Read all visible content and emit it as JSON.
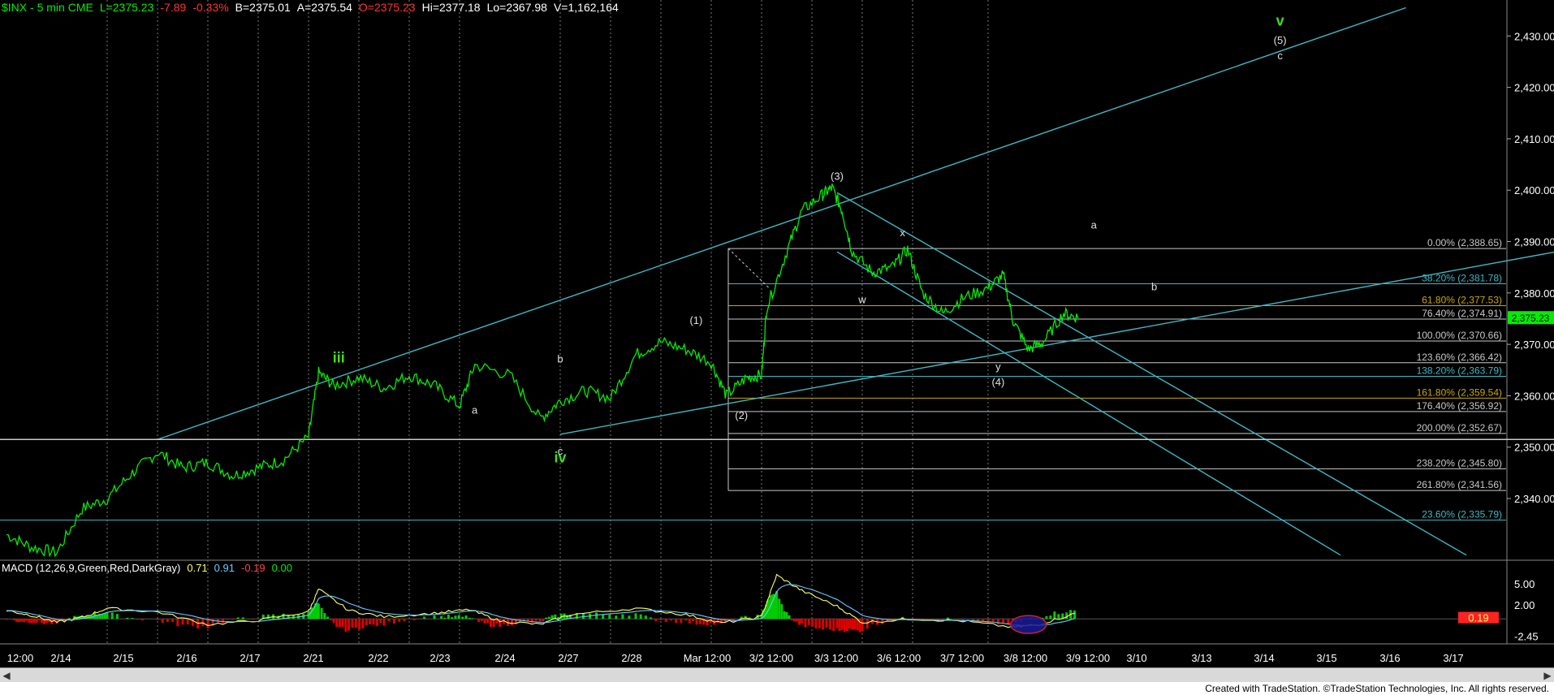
{
  "header": {
    "symbol": "$INX - 5 min  CME",
    "last": "L=2375.23",
    "change": "-7.89",
    "change_pct": "-0.33%",
    "bid": "B=2375.01",
    "ask": "A=2375.54",
    "open": "O=2375.23",
    "high": "Hi=2377.18",
    "low": "Lo=2367.98",
    "volume": "V=1,162,164"
  },
  "macd_header": {
    "name": "MACD (12,26,9,Green,Red,DarkGray)",
    "v1": "0.71",
    "v2": "0.91",
    "v3": "-0.19",
    "v4": "0.00"
  },
  "footer": {
    "credit": "Created with TradeStation. ©TradeStation Technologies, Inc. All rights reserved."
  },
  "colors": {
    "price": "#00ee00",
    "trendline": "#3fb8c4",
    "fib_line": "#c8c8c8",
    "label_white": "#e0e0e0",
    "label_green": "#44dd22",
    "axis_text": "#ffffff",
    "current_price_bg": "#00ee00"
  },
  "chart_data": {
    "type": "line",
    "title": "$INX - 5 min",
    "ylim": [
      2328,
      2437
    ],
    "y_ticks": [
      2340,
      2350,
      2360,
      2370,
      2380,
      2390,
      2400,
      2410,
      2420,
      2430
    ],
    "y_tick_labels": [
      "2,340.00",
      "2,350.00",
      "2,360.00",
      "2,370.00",
      "2,380.00",
      "2,390.00",
      "2,400.00",
      "2,410.00",
      "2,420.00",
      "2,430.00"
    ],
    "x_tick_labels": [
      "12:00",
      "2/14",
      "2/15",
      "2/16",
      "2/17",
      "2/21",
      "2/22",
      "2/23",
      "2/24",
      "2/27",
      "2/28",
      "Mar 12:00",
      "3/2 12:00",
      "3/3 12:00",
      "3/6 12:00",
      "3/7 12:00",
      "3/8 12:00",
      "3/9 12:00",
      "3/10",
      "3/13",
      "3/14",
      "3/15",
      "3/16",
      "3/17"
    ],
    "current_price_label": "2,375.23",
    "price_series": [
      {
        "x": 0.0,
        "y": 2333.0
      },
      {
        "x": 0.5,
        "y": 2330.5
      },
      {
        "x": 1.0,
        "y": 2329.5
      },
      {
        "x": 1.5,
        "y": 2338.0
      },
      {
        "x": 2.0,
        "y": 2340.0
      },
      {
        "x": 2.5,
        "y": 2345.0
      },
      {
        "x": 3.0,
        "y": 2349.0
      },
      {
        "x": 3.5,
        "y": 2346.0
      },
      {
        "x": 4.0,
        "y": 2347.0
      },
      {
        "x": 4.5,
        "y": 2344.5
      },
      {
        "x": 5.0,
        "y": 2346.0
      },
      {
        "x": 5.5,
        "y": 2347.5
      },
      {
        "x": 6.0,
        "y": 2352.0
      },
      {
        "x": 6.2,
        "y": 2364.5
      },
      {
        "x": 6.5,
        "y": 2362.0
      },
      {
        "x": 7.0,
        "y": 2363.5
      },
      {
        "x": 7.5,
        "y": 2361.5
      },
      {
        "x": 8.0,
        "y": 2364.0
      },
      {
        "x": 8.5,
        "y": 2362.0
      },
      {
        "x": 9.0,
        "y": 2358.0
      },
      {
        "x": 9.3,
        "y": 2366.0
      },
      {
        "x": 10.0,
        "y": 2364.0
      },
      {
        "x": 10.6,
        "y": 2355.5
      },
      {
        "x": 11.0,
        "y": 2359.0
      },
      {
        "x": 11.5,
        "y": 2361.0
      },
      {
        "x": 12.0,
        "y": 2359.5
      },
      {
        "x": 12.5,
        "y": 2368.0
      },
      {
        "x": 13.0,
        "y": 2370.5
      },
      {
        "x": 13.5,
        "y": 2369.0
      },
      {
        "x": 14.0,
        "y": 2366.5
      },
      {
        "x": 14.3,
        "y": 2360.0
      },
      {
        "x": 14.7,
        "y": 2363.5
      },
      {
        "x": 15.0,
        "y": 2364.0
      },
      {
        "x": 15.1,
        "y": 2377.0
      },
      {
        "x": 15.5,
        "y": 2388.0
      },
      {
        "x": 15.8,
        "y": 2396.0
      },
      {
        "x": 16.2,
        "y": 2399.0
      },
      {
        "x": 16.4,
        "y": 2400.5
      },
      {
        "x": 16.6,
        "y": 2396.0
      },
      {
        "x": 16.8,
        "y": 2388.0
      },
      {
        "x": 17.2,
        "y": 2384.0
      },
      {
        "x": 17.6,
        "y": 2385.0
      },
      {
        "x": 17.9,
        "y": 2388.5
      },
      {
        "x": 18.2,
        "y": 2380.0
      },
      {
        "x": 18.6,
        "y": 2376.0
      },
      {
        "x": 19.0,
        "y": 2379.0
      },
      {
        "x": 19.5,
        "y": 2381.0
      },
      {
        "x": 19.8,
        "y": 2383.5
      },
      {
        "x": 20.0,
        "y": 2374.5
      },
      {
        "x": 20.3,
        "y": 2369.0
      },
      {
        "x": 20.6,
        "y": 2370.5
      },
      {
        "x": 21.0,
        "y": 2376.0
      },
      {
        "x": 21.3,
        "y": 2375.2
      }
    ],
    "trendlines": [
      {
        "name": "upper-channel",
        "x1": 3.0,
        "y1": 2351.5,
        "x2": 27.8,
        "y2": 2435.5
      },
      {
        "name": "lower-channel",
        "x1": 11.0,
        "y1": 2352.5,
        "x2": 33.0,
        "y2": 2392.0
      },
      {
        "name": "down-channel-top",
        "x1": 16.5,
        "y1": 2399.5,
        "x2": 29.0,
        "y2": 2329.0
      },
      {
        "name": "down-channel-bottom",
        "x1": 16.5,
        "y1": 2388.0,
        "x2": 26.5,
        "y2": 2329.0
      },
      {
        "name": "flat-support",
        "x1": -0.5,
        "y1": 2351.5,
        "x2": 33.0,
        "y2": 2351.5
      }
    ],
    "fib_levels": [
      {
        "pct": "0.00%",
        "price": "2,388.65",
        "value": 2388.65,
        "color": "#c8c8c8"
      },
      {
        "pct": "38.20%",
        "price": "2,381.78",
        "value": 2381.78,
        "color": "#3fb8c4"
      },
      {
        "pct": "61.80%",
        "price": "2,377.53",
        "value": 2377.53,
        "color": "#c8a800"
      },
      {
        "pct": "76.40%",
        "price": "2,374.91",
        "value": 2374.91,
        "color": "#c8c8c8"
      },
      {
        "pct": "100.00%",
        "price": "2,370.66",
        "value": 2370.66,
        "color": "#c8c8c8"
      },
      {
        "pct": "123.60%",
        "price": "2,366.42",
        "value": 2366.42,
        "color": "#c8c8c8"
      },
      {
        "pct": "138.20%",
        "price": "2,363.79",
        "value": 2363.79,
        "color": "#3fb8c4"
      },
      {
        "pct": "161.80%",
        "price": "2,359.54",
        "value": 2359.54,
        "color": "#c8a800"
      },
      {
        "pct": "176.40%",
        "price": "2,356.92",
        "value": 2356.92,
        "color": "#c8c8c8"
      },
      {
        "pct": "200.00%",
        "price": "2,352.67",
        "value": 2352.67,
        "color": "#c8c8c8"
      },
      {
        "pct": "238.20%",
        "price": "2,345.80",
        "value": 2345.8,
        "color": "#c8c8c8"
      },
      {
        "pct": "261.80%",
        "price": "2,341.56",
        "value": 2341.56,
        "color": "#c8c8c8"
      },
      {
        "pct": "23.60%",
        "price": "2,335.79",
        "value": 2335.79,
        "color": "#3fb8c4"
      }
    ],
    "wave_labels": [
      {
        "text": "iii",
        "x": 6.6,
        "y": 2366.5,
        "color": "green"
      },
      {
        "text": "iv",
        "x": 11.0,
        "y": 2347.0,
        "color": "green"
      },
      {
        "text": "v",
        "x": 25.3,
        "y": 2432.0,
        "color": "green"
      },
      {
        "text": "a",
        "x": 9.3,
        "y": 2356.5,
        "color": "white"
      },
      {
        "text": "b",
        "x": 11.0,
        "y": 2366.5,
        "color": "white"
      },
      {
        "text": "c",
        "x": 11.0,
        "y": 2348.5,
        "color": "white"
      },
      {
        "text": "(1)",
        "x": 13.7,
        "y": 2374.0,
        "color": "white"
      },
      {
        "text": "(2)",
        "x": 14.6,
        "y": 2355.5,
        "color": "white"
      },
      {
        "text": "(3)",
        "x": 16.5,
        "y": 2402.0,
        "color": "white"
      },
      {
        "text": "w",
        "x": 17.0,
        "y": 2378.0,
        "color": "white"
      },
      {
        "text": "x",
        "x": 17.8,
        "y": 2391.0,
        "color": "white"
      },
      {
        "text": "y",
        "x": 19.7,
        "y": 2365.0,
        "color": "white"
      },
      {
        "text": "(4)",
        "x": 19.7,
        "y": 2362.0,
        "color": "white"
      },
      {
        "text": "a",
        "x": 21.6,
        "y": 2392.5,
        "color": "white"
      },
      {
        "text": "b",
        "x": 22.8,
        "y": 2380.5,
        "color": "white"
      },
      {
        "text": "(5)",
        "x": 25.3,
        "y": 2428.5,
        "color": "white"
      },
      {
        "text": "c",
        "x": 25.3,
        "y": 2425.5,
        "color": "white"
      }
    ],
    "macd": {
      "ylim": [
        -3.2,
        6.6
      ],
      "y_tick_labels": [
        "5.00",
        "2.00",
        "0.19",
        "-2.45"
      ],
      "y_tick_values": [
        5.0,
        2.0,
        0.19,
        -2.45
      ],
      "macd_series": [
        {
          "x": 0,
          "y": 1.2
        },
        {
          "x": 0.5,
          "y": 0.5
        },
        {
          "x": 1,
          "y": -0.5
        },
        {
          "x": 1.5,
          "y": 0.2
        },
        {
          "x": 2,
          "y": 1.5
        },
        {
          "x": 3,
          "y": 1.0
        },
        {
          "x": 4,
          "y": -0.8
        },
        {
          "x": 5,
          "y": -0.2
        },
        {
          "x": 6,
          "y": 1.0
        },
        {
          "x": 6.2,
          "y": 4.2
        },
        {
          "x": 6.8,
          "y": 1.2
        },
        {
          "x": 7.5,
          "y": 0.3
        },
        {
          "x": 8.5,
          "y": 0.8
        },
        {
          "x": 9.2,
          "y": 1.3
        },
        {
          "x": 9.8,
          "y": -0.3
        },
        {
          "x": 10.6,
          "y": -0.8
        },
        {
          "x": 11.2,
          "y": 0.6
        },
        {
          "x": 12.5,
          "y": 1.5
        },
        {
          "x": 13.5,
          "y": 0.6
        },
        {
          "x": 14.2,
          "y": -0.6
        },
        {
          "x": 15.0,
          "y": 0.3
        },
        {
          "x": 15.3,
          "y": 6.2
        },
        {
          "x": 15.8,
          "y": 4.0
        },
        {
          "x": 16.5,
          "y": 1.8
        },
        {
          "x": 17.0,
          "y": -0.5
        },
        {
          "x": 18.0,
          "y": 0.0
        },
        {
          "x": 19.0,
          "y": -0.3
        },
        {
          "x": 20.0,
          "y": -1.2
        },
        {
          "x": 20.5,
          "y": -0.8
        },
        {
          "x": 21.3,
          "y": 0.9
        }
      ]
    }
  }
}
